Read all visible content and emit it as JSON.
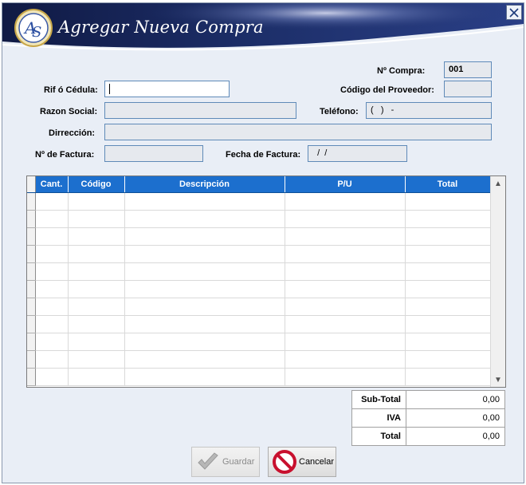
{
  "window": {
    "title": "Agregar Nueva Compra",
    "logo_icon": "ars-logo-icon",
    "close_label": "×"
  },
  "form": {
    "n_compra": {
      "label": "Nº Compra:",
      "value": "001"
    },
    "rif": {
      "label": "Rif ó Cédula:",
      "value": ""
    },
    "codigo_proveedor": {
      "label": "Código del Proveedor:",
      "value": ""
    },
    "razon_social": {
      "label": "Razon Social:",
      "value": ""
    },
    "telefono": {
      "label": "Teléfono:",
      "value": "(   )   -"
    },
    "direccion": {
      "label": "Dirrección:",
      "value": ""
    },
    "n_factura": {
      "label": "Nº de Factura:",
      "value": ""
    },
    "fecha_factura": {
      "label": "Fecha de Factura:",
      "value": "  /  /"
    }
  },
  "grid": {
    "columns": [
      "Cant.",
      "Código",
      "Descripción",
      "P/U",
      "Total"
    ],
    "empty_rows": 11,
    "scroll_up": "▲",
    "scroll_down": "▼",
    "header_color": "#1c6fce"
  },
  "totals": {
    "subtotal_label": "Sub-Total",
    "subtotal_value": "0,00",
    "iva_label": "IVA",
    "iva_value": "0,00",
    "total_label": "Total",
    "total_value": "0,00"
  },
  "buttons": {
    "guardar": {
      "label": "Guardar",
      "icon": "checkmark-icon",
      "enabled": false
    },
    "cancelar": {
      "label": "Cancelar",
      "icon": "cancel-icon",
      "enabled": true
    }
  }
}
